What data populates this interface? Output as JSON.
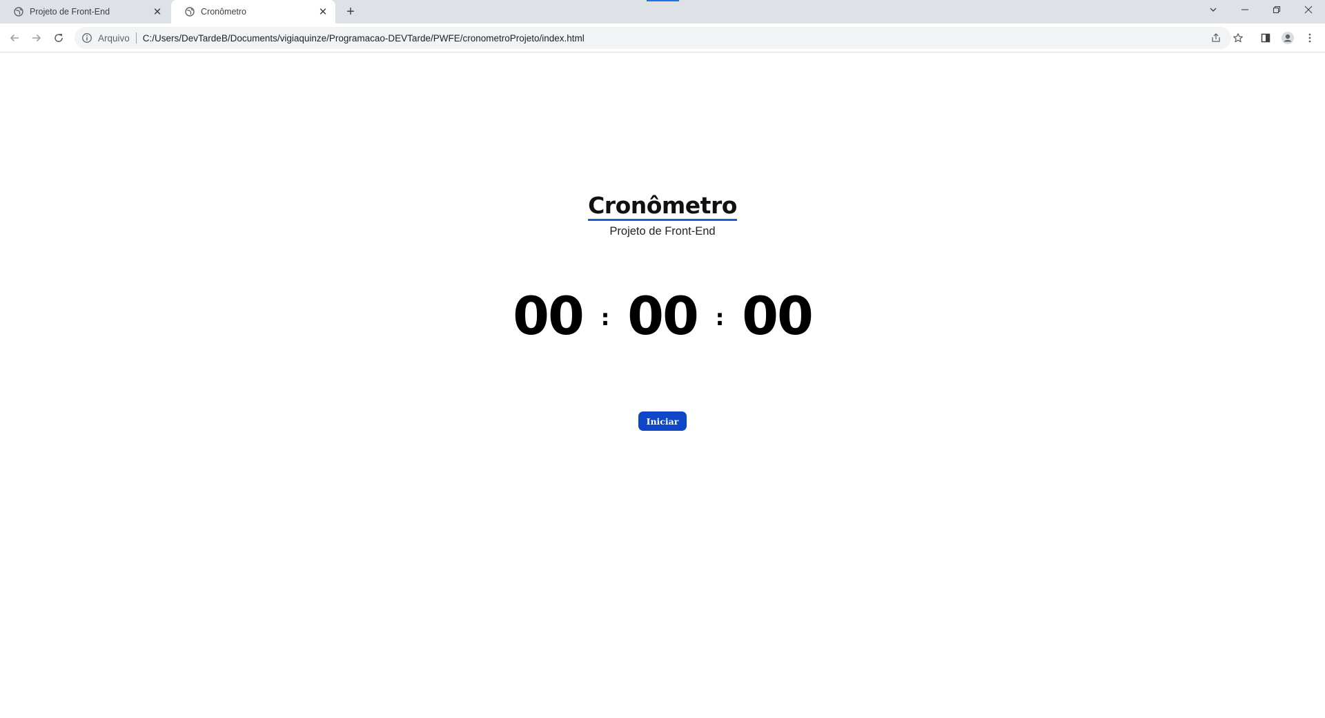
{
  "browser": {
    "tabs": [
      {
        "title": "Projeto de Front-End",
        "active": false
      },
      {
        "title": "Cronômetro",
        "active": true
      }
    ],
    "omnibox": {
      "scheme_label": "Arquivo",
      "url": "C:/Users/DevTardeB/Documents/vigiaquinze/Programacao-DEVTarde/PWFE/cronometroProjeto/index.html"
    },
    "icons": {
      "tab_favicon": "globe-icon",
      "tab_close": "close-icon",
      "new_tab": "plus-icon",
      "back": "back-arrow-icon",
      "forward": "forward-arrow-icon",
      "reload": "reload-icon",
      "site_info": "info-icon",
      "share": "share-icon",
      "bookmark": "star-icon",
      "side_panel": "side-panel-icon",
      "profile": "profile-icon",
      "menu": "kebab-menu-icon",
      "tab_search": "chevron-down-icon",
      "minimize": "minimize-icon",
      "restore": "restore-icon",
      "close_window": "close-window-icon"
    }
  },
  "page": {
    "title": "Cronômetro",
    "subtitle": "Projeto de Front-End",
    "timer": {
      "hours": "00",
      "minutes": "00",
      "seconds": "00",
      "separator": ":"
    },
    "start_button_label": "Iniciar"
  },
  "colors": {
    "accent_blue": "#0d47c7",
    "title_underline": "#1e5bd6",
    "chrome_bg": "#dee1e6",
    "omnibox_bg": "#f1f3f4"
  }
}
